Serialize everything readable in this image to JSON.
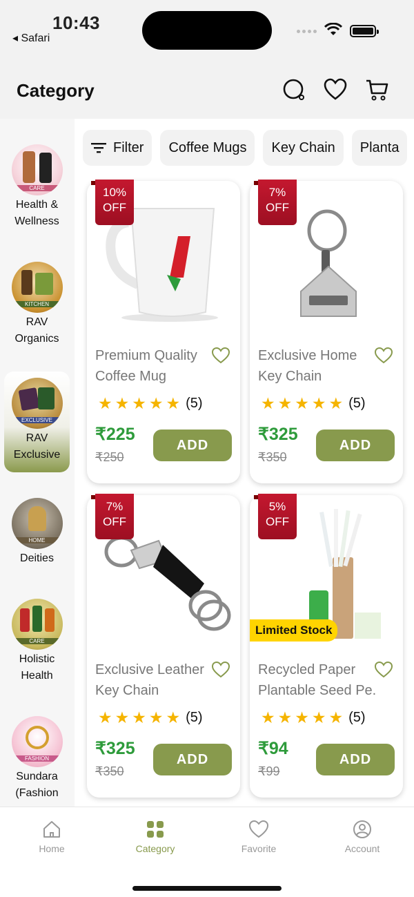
{
  "status_bar": {
    "time": "10:43",
    "back_app": "◂ Safari"
  },
  "header": {
    "title": "Category"
  },
  "sidebar": {
    "items": [
      {
        "label": "Health &\nWellness",
        "badge": "CARE"
      },
      {
        "label": "RAV\nOrganics",
        "badge": "KITCHEN"
      },
      {
        "label": "RAV\nExclusive",
        "badge": "EXCLUSIVE"
      },
      {
        "label": "Deities",
        "badge": "HOME"
      },
      {
        "label": "Holistic\nHealth",
        "badge": "CARE"
      },
      {
        "label": "Sundara\n(Fashion",
        "badge": "FASHION"
      }
    ]
  },
  "chips": {
    "filter": "Filter",
    "items": [
      "Coffee Mugs",
      "Key Chain",
      "Planta"
    ]
  },
  "products": [
    {
      "badge_pct": "10%",
      "badge_off": "OFF",
      "name1": "Premium Quality",
      "name2": "Coffee Mug",
      "rating_count": "(5)",
      "price": "₹225",
      "mrp": "₹250",
      "add": "ADD"
    },
    {
      "badge_pct": "7%",
      "badge_off": "OFF",
      "name1": "Exclusive Home",
      "name2": "Key Chain",
      "rating_count": "(5)",
      "price": "₹325",
      "mrp": "₹350",
      "add": "ADD"
    },
    {
      "badge_pct": "7%",
      "badge_off": "OFF",
      "name1": "Exclusive Leather",
      "name2": "Key Chain",
      "rating_count": "(5)",
      "price": "₹325",
      "mrp": "₹350",
      "add": "ADD"
    },
    {
      "badge_pct": "5%",
      "badge_off": "OFF",
      "name1": "Recycled Paper",
      "name2": "Plantable Seed Pe...",
      "rating_count": "(5)",
      "price": "₹94",
      "mrp": "₹99",
      "add": "ADD",
      "tag": "Limited Stock"
    }
  ],
  "bottom_nav": {
    "home": "Home",
    "category": "Category",
    "favorite": "Favorite",
    "account": "Account"
  },
  "colors": {
    "accent": "#889a4d",
    "price": "#2e9b3b",
    "badge": "#c4182f",
    "star": "#f5b400",
    "limited": "#ffd400"
  }
}
